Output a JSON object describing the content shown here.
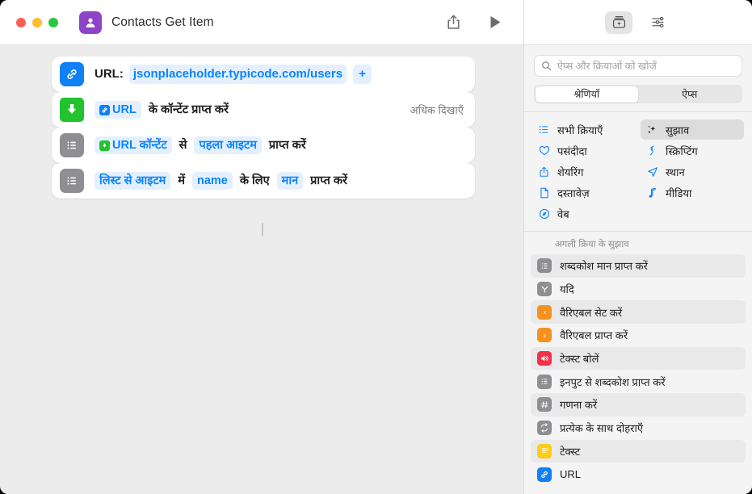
{
  "window": {
    "title": "Contacts Get Item",
    "app_icon": "contacts-person-icon",
    "traffic_lights": [
      "close",
      "minimize",
      "zoom"
    ],
    "share_icon": "share-icon",
    "play_icon": "play-icon"
  },
  "workflow": {
    "actions": [
      {
        "id": "url",
        "icon": "link-icon",
        "icon_color": "#1080f5",
        "label": "URL:",
        "value": "jsonplaceholder.typicode.com/users",
        "add_label": "+"
      },
      {
        "id": "get-contents-of-url",
        "icon": "download-arrow-icon",
        "icon_color": "#21c32f",
        "token": "URL",
        "token_glyph": "link-icon",
        "text_after": "के कॉन्टेंट प्राप्त करें",
        "show_more": "अधिक दिखाएँ"
      },
      {
        "id": "get-item-from-list",
        "icon": "list-icon",
        "icon_color": "#8e8e93",
        "token1": "URL कॉन्टेंट",
        "token1_glyph": "download-arrow-icon",
        "mid1": "से",
        "token2": "पहला आइटम",
        "text_after": "प्राप्त करें"
      },
      {
        "id": "get-dictionary-value",
        "icon": "list-icon",
        "icon_color": "#8e8e93",
        "token1": "लिस्ट से आइटम",
        "mid1": "में",
        "token2": "name",
        "mid2": "के लिए",
        "token3": "मान",
        "text_after": "प्राप्त करें"
      }
    ]
  },
  "panel": {
    "toolbar": {
      "library_icon": "action-library-icon",
      "settings_icon": "sliders-icon"
    },
    "search": {
      "placeholder": "ऐप्स और क्रियाओं को खोजें",
      "value": "",
      "icon": "search-icon"
    },
    "segments": [
      {
        "label": "श्रेणियाँ",
        "active": true
      },
      {
        "label": "ऐप्स",
        "active": false
      }
    ],
    "categories": [
      {
        "label": "सभी क्रियाएँ",
        "icon": "list-bullet-icon",
        "selected": false
      },
      {
        "label": "सुझाव",
        "icon": "sparkles-icon",
        "selected": true
      },
      {
        "label": "पसंदीदा",
        "icon": "heart-icon",
        "selected": false
      },
      {
        "label": "स्क्रिप्टिंग",
        "icon": "scripting-icon",
        "selected": false
      },
      {
        "label": "शेयरिंग",
        "icon": "share-icon",
        "selected": false
      },
      {
        "label": "स्थान",
        "icon": "location-arrow-icon",
        "selected": false
      },
      {
        "label": "दस्तावेज़",
        "icon": "document-icon",
        "selected": false
      },
      {
        "label": "मीडिया",
        "icon": "music-note-icon",
        "selected": false
      },
      {
        "label": "वेब",
        "icon": "safari-compass-icon",
        "selected": false
      }
    ],
    "suggestions_header": "अगली क्रिया के सुझाव",
    "suggestions": [
      {
        "label": "शब्दकोश मान प्राप्त करें",
        "icon": "list-icon",
        "icon_color": "#8e8e93"
      },
      {
        "label": "यदि",
        "icon": "branch-icon",
        "icon_color": "#8e8e93"
      },
      {
        "label": "वैरिएबल सेट करें",
        "icon": "variable-icon",
        "icon_color": "#f5921f"
      },
      {
        "label": "वैरिएबल प्राप्त करें",
        "icon": "variable-icon",
        "icon_color": "#f5921f"
      },
      {
        "label": "टेक्स्ट बोलें",
        "icon": "speaker-icon",
        "icon_color": "#f5314a"
      },
      {
        "label": "इनपुट से शब्दकोश प्राप्त करें",
        "icon": "list-icon",
        "icon_color": "#8e8e93"
      },
      {
        "label": "गणना करें",
        "icon": "hash-icon",
        "icon_color": "#8e8e93"
      },
      {
        "label": "प्रत्येक के साथ दोहराएँ",
        "icon": "repeat-icon",
        "icon_color": "#8e8e93"
      },
      {
        "label": "टेक्स्ट",
        "icon": "text-icon",
        "icon_color": "#ffcc18"
      },
      {
        "label": "URL",
        "icon": "link-icon",
        "icon_color": "#1080f5"
      }
    ]
  }
}
